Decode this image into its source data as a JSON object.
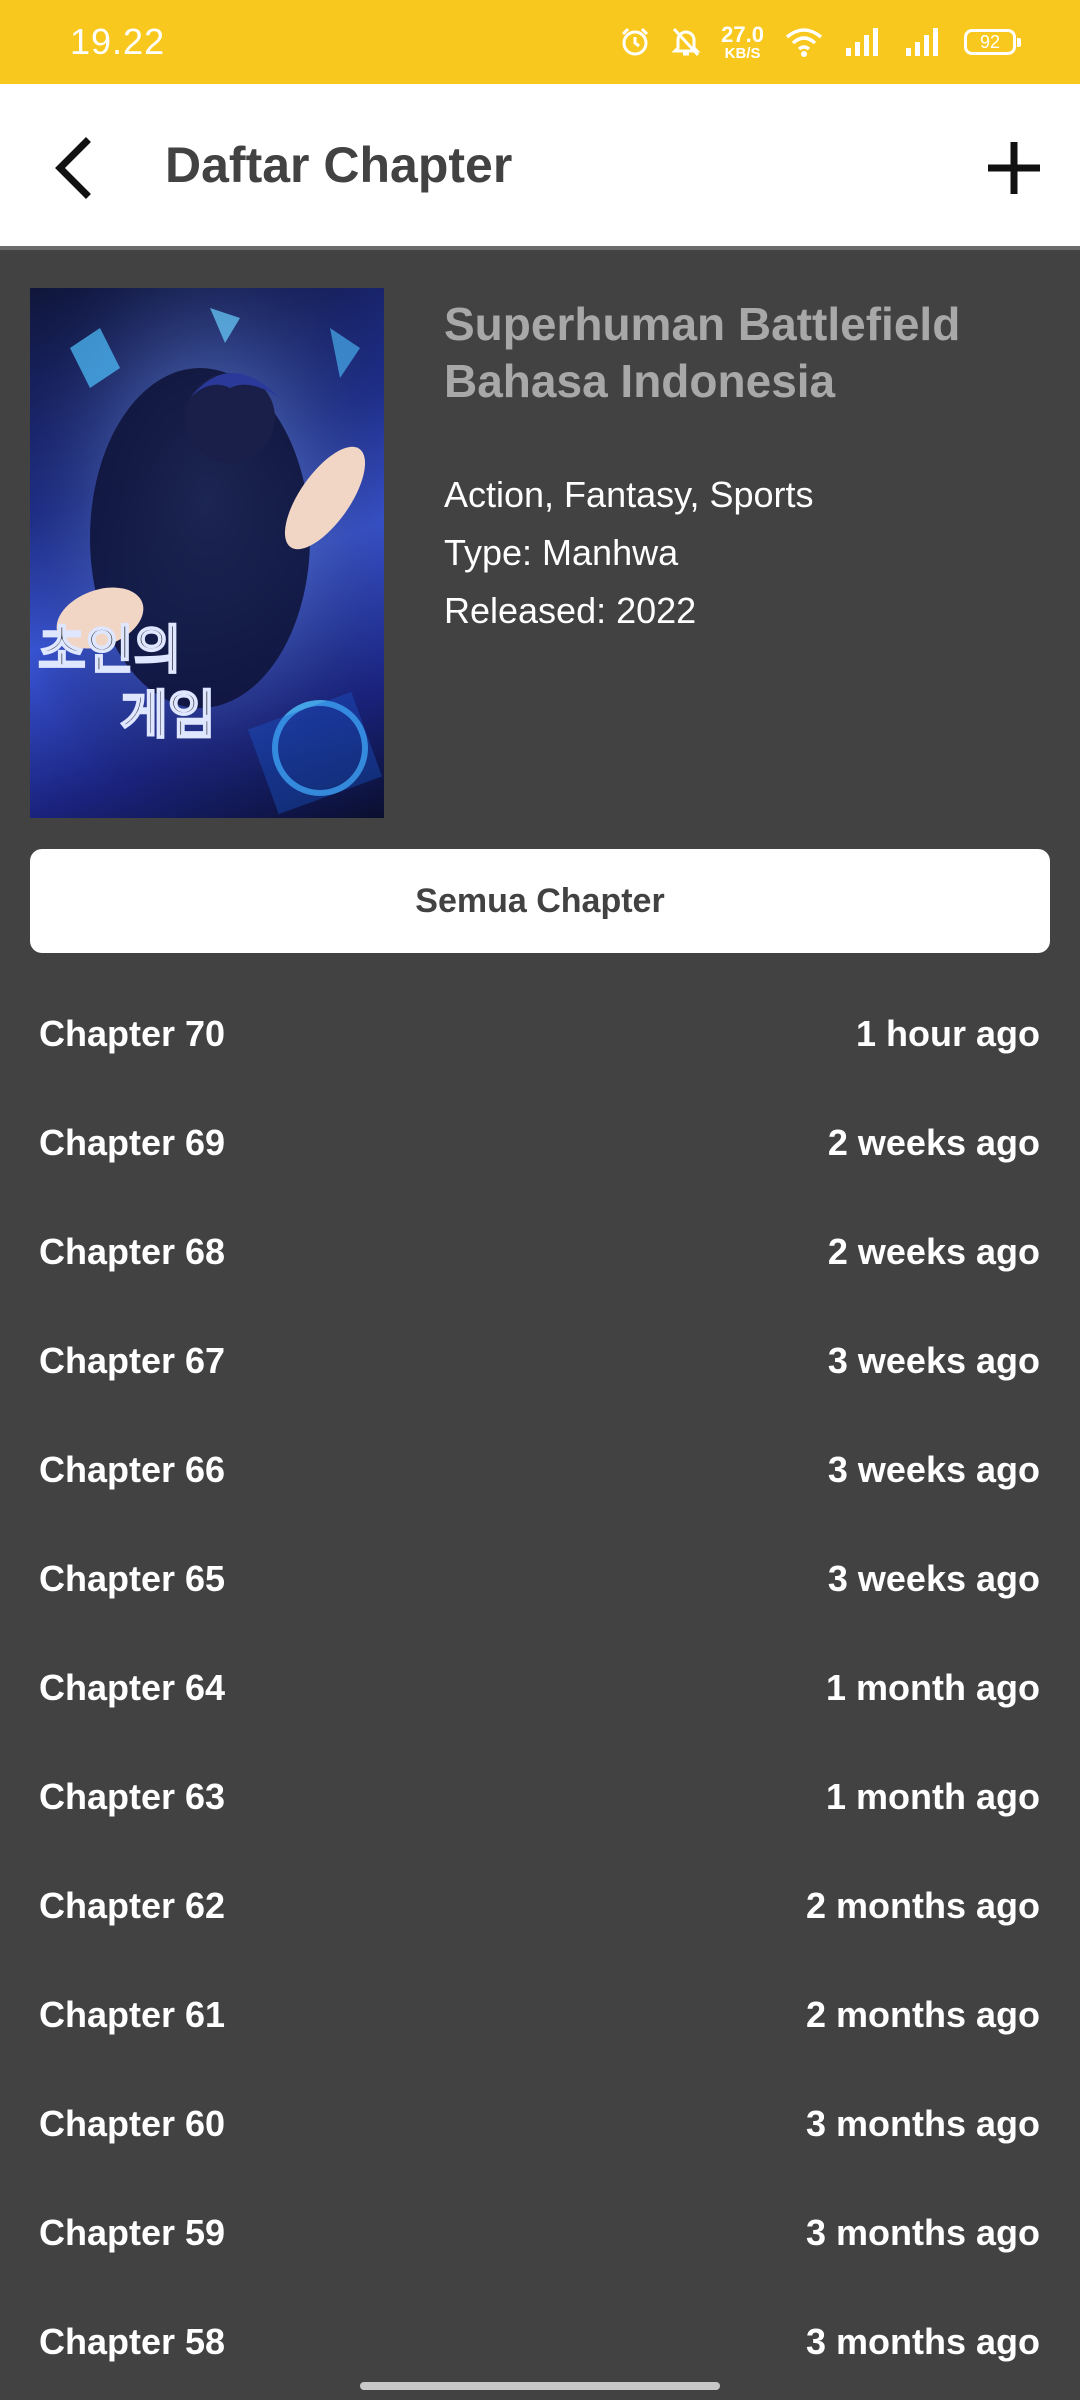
{
  "status_bar": {
    "time": "19.22",
    "net_speed_value": "27.0",
    "net_speed_unit": "KB/S",
    "battery": "92",
    "icons": [
      "alarm-icon",
      "bell-muted-icon",
      "wifi-icon",
      "signal-icon",
      "signal-icon",
      "battery-icon"
    ]
  },
  "app_bar": {
    "title": "Daftar Chapter",
    "back_icon": "back-arrow-icon",
    "add_icon": "plus-icon"
  },
  "manga": {
    "title": "Superhuman Battlefield Bahasa Indonesia",
    "genres": "Action, Fantasy, Sports",
    "type": "Type: Manhwa",
    "released": "Released: 2022"
  },
  "all_chapters_label": "Semua Chapter",
  "chapters": [
    {
      "name": "Chapter 70",
      "time": "1 hour ago"
    },
    {
      "name": "Chapter 69",
      "time": "2 weeks ago"
    },
    {
      "name": "Chapter 68",
      "time": "2 weeks ago"
    },
    {
      "name": "Chapter 67",
      "time": "3 weeks ago"
    },
    {
      "name": "Chapter 66",
      "time": "3 weeks ago"
    },
    {
      "name": "Chapter 65",
      "time": "3 weeks ago"
    },
    {
      "name": "Chapter 64",
      "time": "1 month ago"
    },
    {
      "name": "Chapter 63",
      "time": "1 month ago"
    },
    {
      "name": "Chapter 62",
      "time": "2 months ago"
    },
    {
      "name": "Chapter 61",
      "time": "2 months ago"
    },
    {
      "name": "Chapter 60",
      "time": "3 months ago"
    },
    {
      "name": "Chapter 59",
      "time": "3 months ago"
    },
    {
      "name": "Chapter 58",
      "time": "3 months ago"
    }
  ],
  "colors": {
    "status_bar": "#f9c81e",
    "background": "#424242",
    "title_gray": "#a8a8a8"
  }
}
